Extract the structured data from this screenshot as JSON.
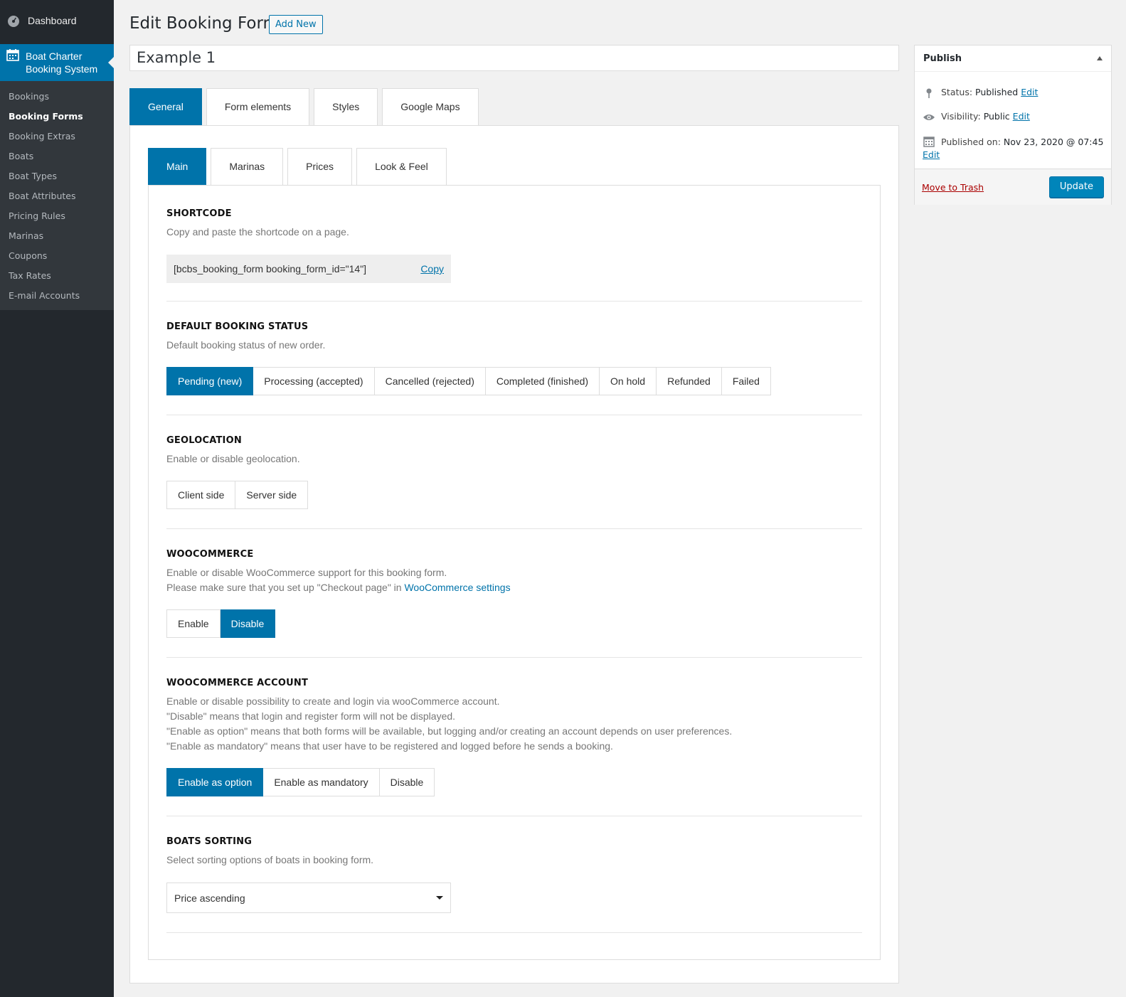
{
  "sidebar": {
    "dashboard_label": "Dashboard",
    "current_menu_label_1": "Boat Charter",
    "current_menu_label_2": "Booking System",
    "submenu": [
      "Bookings",
      "Booking Forms",
      "Booking Extras",
      "Boats",
      "Boat Types",
      "Boat Attributes",
      "Pricing Rules",
      "Marinas",
      "Coupons",
      "Tax Rates",
      "E-mail Accounts"
    ],
    "active_submenu": "Booking Forms"
  },
  "header": {
    "title": "Edit Booking Form",
    "add_new_label": "Add New",
    "post_title_value": "Example 1"
  },
  "outer_tabs": [
    "General",
    "Form elements",
    "Styles",
    "Google Maps"
  ],
  "inner_tabs": [
    "Main",
    "Marinas",
    "Prices",
    "Look & Feel"
  ],
  "sections": {
    "shortcode": {
      "heading": "SHORTCODE",
      "description": "Copy and paste the shortcode on a page.",
      "value": "[bcbs_booking_form booking_form_id=\"14\"]",
      "copy_label": "Copy"
    },
    "booking_status": {
      "heading": "DEFAULT BOOKING STATUS",
      "description": "Default booking status of new order.",
      "options": [
        "Pending (new)",
        "Processing (accepted)",
        "Cancelled (rejected)",
        "Completed (finished)",
        "On hold",
        "Refunded",
        "Failed"
      ],
      "selected": "Pending (new)"
    },
    "geolocation": {
      "heading": "GEOLOCATION",
      "description": "Enable or disable geolocation.",
      "options": [
        "Client side",
        "Server side"
      ],
      "selected": ""
    },
    "woocommerce": {
      "heading": "WOOCOMMERCE",
      "description_1": "Enable or disable WooCommerce support for this booking form.",
      "description_2": "Please make sure that you set up \"Checkout page\" in ",
      "link_label": "WooCommerce settings",
      "options": [
        "Enable",
        "Disable"
      ],
      "selected": "Disable"
    },
    "woocommerce_account": {
      "heading": "WOOCOMMERCE ACCOUNT",
      "lines": [
        "Enable or disable possibility to create and login via wooCommerce account.",
        "\"Disable\" means that login and register form will not be displayed.",
        "\"Enable as option\" means that both forms will be available, but logging and/or creating an account depends on user preferences.",
        "\"Enable as mandatory\" means that user have to be registered and logged before he sends a booking."
      ],
      "options": [
        "Enable as option",
        "Enable as mandatory",
        "Disable"
      ],
      "selected": "Enable as option"
    },
    "boats_sorting": {
      "heading": "BOATS SORTING",
      "description": "Select sorting options of boats in booking form.",
      "selected_value": "Price ascending"
    }
  },
  "publish": {
    "title": "Publish",
    "status_label": "Status:",
    "status_value": "Published",
    "visibility_label": "Visibility:",
    "visibility_value": "Public",
    "published_label": "Published on:",
    "published_value": "Nov 23, 2020 @ 07:45",
    "edit_label": "Edit",
    "trash_label": "Move to Trash",
    "update_label": "Update"
  },
  "colors": {
    "accent": "#0073aa",
    "sidebar": "#23282d",
    "submenu": "#32373c",
    "trash": "#a00000"
  }
}
